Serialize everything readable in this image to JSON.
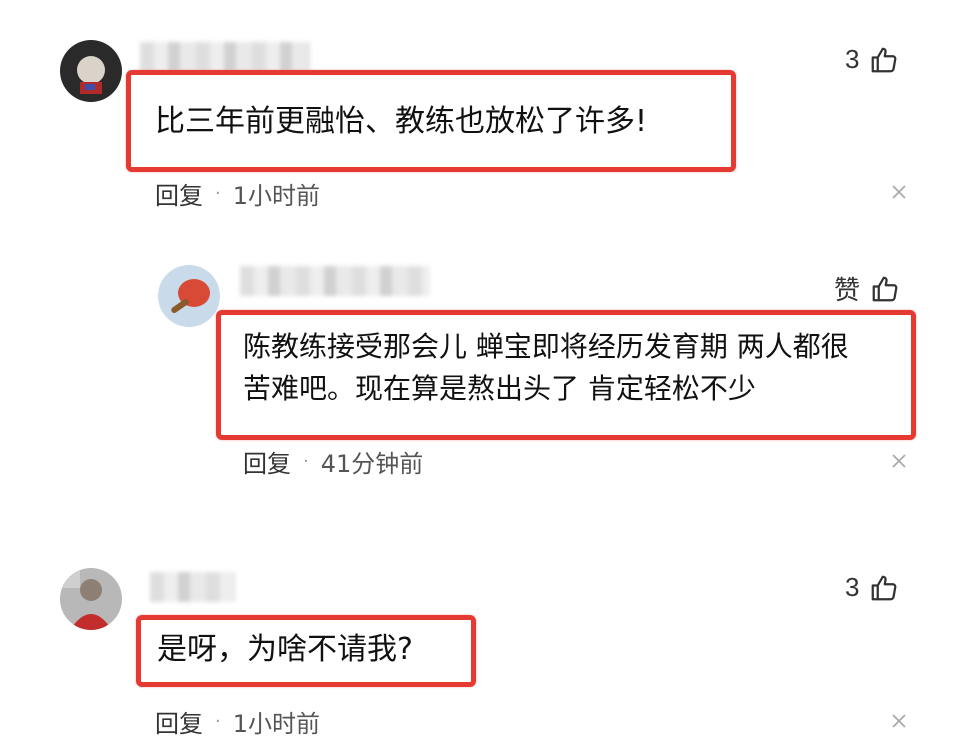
{
  "comments": [
    {
      "likes": "3",
      "text": "比三年前更融怡、教练也放松了许多!",
      "reply_label": "回复",
      "separator": "·",
      "time": "1小时前"
    },
    {
      "likes": "赞",
      "text_line1": "陈教练接受那会儿 蝉宝即将经历发育期 两人都很",
      "text_line2": "苦难吧。现在算是熬出头了 肯定轻松不少",
      "reply_label": "回复",
      "separator": "·",
      "time": "41分钟前"
    },
    {
      "likes": "3",
      "text": "是呀，为啥不请我?",
      "reply_label": "回复",
      "separator": "·",
      "time": "1小时前"
    }
  ],
  "colors": {
    "highlight": "#e43a32",
    "text": "#111111",
    "meta": "#333333"
  },
  "icons": {
    "like": "thumbs-up-icon",
    "close": "close-icon"
  }
}
